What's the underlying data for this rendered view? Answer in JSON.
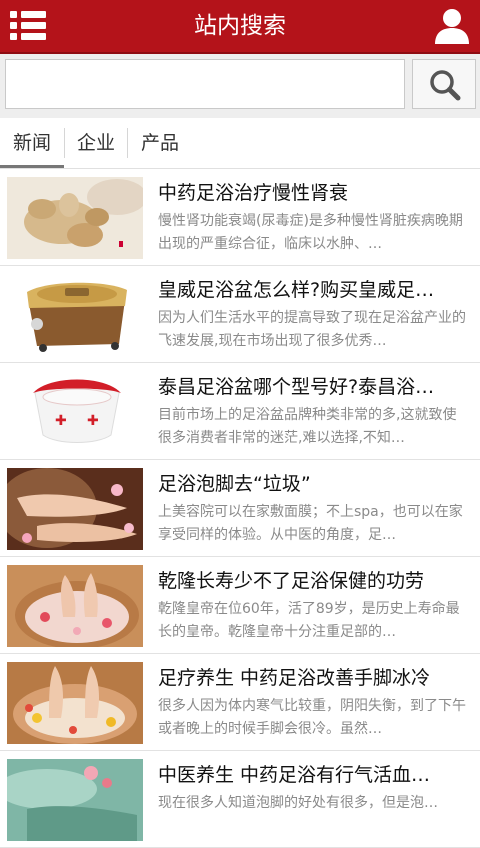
{
  "header": {
    "title": "站内搜索",
    "menu_icon": "list-menu-icon",
    "user_icon": "user-icon",
    "bg_color": "#b4131a"
  },
  "search": {
    "placeholder": "",
    "button_icon": "search-icon"
  },
  "tabs": [
    {
      "label": "新闻",
      "active": true
    },
    {
      "label": "企业",
      "active": false
    },
    {
      "label": "产品",
      "active": false
    }
  ],
  "articles": [
    {
      "title": "中药足浴治疗慢性肾衰",
      "desc": "慢性肾功能衰竭(尿毒症)是多种慢性肾脏疾病晚期出现的严重综合征，临床以水肿、…",
      "image": "ginger-photo"
    },
    {
      "title": "皇威足浴盆怎么样?购买皇威足…",
      "desc": "因为人们生活水平的提高导致了现在足浴盆产业的飞速发展,现在市场出现了很多优秀…",
      "image": "footbath-basin-gold-photo"
    },
    {
      "title": "泰昌足浴盆哪个型号好?泰昌浴…",
      "desc": "目前市场上的足浴盆品牌种类非常的多,这就致使很多消费者非常的迷茫,难以选择,不知…",
      "image": "footbath-basin-red-white-photo"
    },
    {
      "title": "足浴泡脚去“垃圾”",
      "desc": "上美容院可以在家敷面膜；不上spa，也可以在家享受同样的体验。从中医的角度，足…",
      "image": "feet-rose-petals-photo"
    },
    {
      "title": "乾隆长寿少不了足浴保健的功劳",
      "desc": "乾隆皇帝在位60年，活了89岁，是历史上寿命最长的皇帝。乾隆皇帝十分注重足部的…",
      "image": "feet-flower-basin-photo"
    },
    {
      "title": "足疗养生 中药足浴改善手脚冰冷",
      "desc": "很多人因为体内寒气比较重，阴阳失衡，到了下午或者晚上的时候手脚会很冷。虽然…",
      "image": "feet-yellow-petals-photo"
    },
    {
      "title": "中医养生 中药足浴有行气活血…",
      "desc": "现在很多人知道泡脚的好处有很多，但是泡…",
      "image": "feet-water-photo"
    }
  ]
}
